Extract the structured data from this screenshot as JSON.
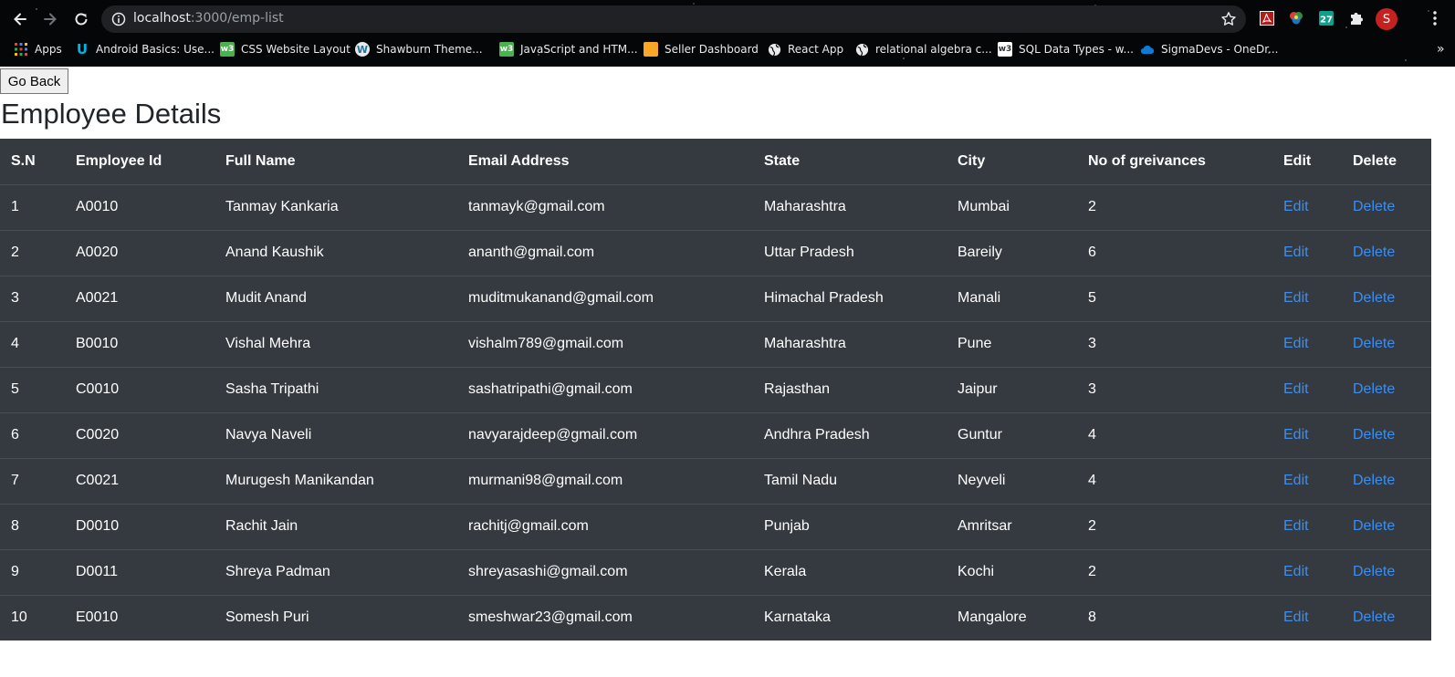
{
  "browser": {
    "url_host": "localhost",
    "url_path": ":3000/emp-list",
    "profile_initial": "S",
    "bookmarks": [
      {
        "label": "Apps",
        "icon": "apps-grid-icon",
        "color": "#ea4335"
      },
      {
        "label": "Android Basics: Use...",
        "icon": "udacity-icon",
        "color": "#02b3e4"
      },
      {
        "label": "CSS Website Layout",
        "icon": "w3schools-icon",
        "color": "#4caf50"
      },
      {
        "label": "Shawburn Theme...",
        "icon": "wordpress-icon",
        "color": "#21759b"
      },
      {
        "label": "JavaScript and HTM...",
        "icon": "w3schools-icon",
        "color": "#4caf50"
      },
      {
        "label": "Seller Dashboard",
        "icon": "seller-icon",
        "color": "#f9a825"
      },
      {
        "label": "React App",
        "icon": "globe-icon",
        "color": "#e8eaed"
      },
      {
        "label": "relational algebra c...",
        "icon": "globe-icon",
        "color": "#e8eaed"
      },
      {
        "label": "SQL Data Types - w...",
        "icon": "w3schools-icon",
        "color": "#ffffff"
      },
      {
        "label": "SigmaDevs - OneDr...",
        "icon": "onedrive-icon",
        "color": "#0a7cd6"
      }
    ],
    "more_bookmarks": "»"
  },
  "page": {
    "go_back_label": "Go Back",
    "title": "Employee Details"
  },
  "table": {
    "headers": [
      "S.N",
      "Employee Id",
      "Full Name",
      "Email Address",
      "State",
      "City",
      "No of greivances",
      "Edit",
      "Delete"
    ],
    "rows": [
      {
        "sn": "1",
        "id": "A0010",
        "name": "Tanmay Kankaria",
        "email": "tanmayk@gmail.com",
        "state": "Maharashtra",
        "city": "Mumbai",
        "grievances": "2",
        "edit": "Edit",
        "delete": "Delete"
      },
      {
        "sn": "2",
        "id": "A0020",
        "name": "Anand Kaushik",
        "email": "ananth@gmail.com",
        "state": "Uttar Pradesh",
        "city": "Bareily",
        "grievances": "6",
        "edit": "Edit",
        "delete": "Delete"
      },
      {
        "sn": "3",
        "id": "A0021",
        "name": "Mudit Anand",
        "email": "muditmukanand@gmail.com",
        "state": "Himachal Pradesh",
        "city": "Manali",
        "grievances": "5",
        "edit": "Edit",
        "delete": "Delete"
      },
      {
        "sn": "4",
        "id": "B0010",
        "name": "Vishal Mehra",
        "email": "vishalm789@gmail.com",
        "state": "Maharashtra",
        "city": "Pune",
        "grievances": "3",
        "edit": "Edit",
        "delete": "Delete"
      },
      {
        "sn": "5",
        "id": "C0010",
        "name": "Sasha Tripathi",
        "email": "sashatripathi@gmail.com",
        "state": "Rajasthan",
        "city": "Jaipur",
        "grievances": "3",
        "edit": "Edit",
        "delete": "Delete"
      },
      {
        "sn": "6",
        "id": "C0020",
        "name": "Navya Naveli",
        "email": "navyarajdeep@gmail.com",
        "state": "Andhra Pradesh",
        "city": "Guntur",
        "grievances": "4",
        "edit": "Edit",
        "delete": "Delete"
      },
      {
        "sn": "7",
        "id": "C0021",
        "name": "Murugesh Manikandan",
        "email": "murmani98@gmail.com",
        "state": "Tamil Nadu",
        "city": "Neyveli",
        "grievances": "4",
        "edit": "Edit",
        "delete": "Delete"
      },
      {
        "sn": "8",
        "id": "D0010",
        "name": "Rachit Jain",
        "email": "rachitj@gmail.com",
        "state": "Punjab",
        "city": "Amritsar",
        "grievances": "2",
        "edit": "Edit",
        "delete": "Delete"
      },
      {
        "sn": "9",
        "id": "D0011",
        "name": "Shreya Padman",
        "email": "shreyasashi@gmail.com",
        "state": "Kerala",
        "city": "Kochi",
        "grievances": "2",
        "edit": "Edit",
        "delete": "Delete"
      },
      {
        "sn": "10",
        "id": "E0010",
        "name": "Somesh Puri",
        "email": "smeshwar23@gmail.com",
        "state": "Karnataka",
        "city": "Mangalore",
        "grievances": "8",
        "edit": "Edit",
        "delete": "Delete"
      }
    ]
  },
  "colors": {
    "table_bg": "#343a40",
    "row_border": "#454d55",
    "link": "#3b8ff2"
  }
}
